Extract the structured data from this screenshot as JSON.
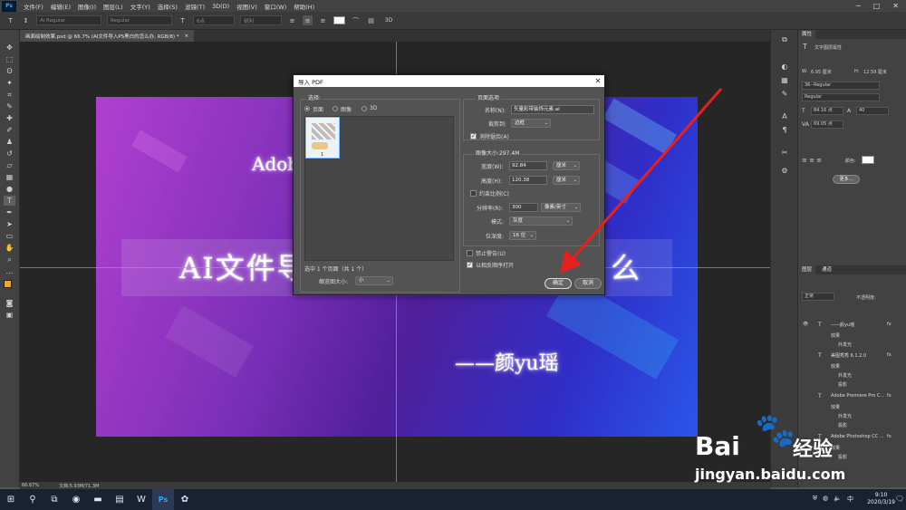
{
  "app": {
    "logo": "Ps",
    "menu": [
      "文件(F)",
      "编辑(E)",
      "图像(I)",
      "图层(L)",
      "文字(Y)",
      "选择(S)",
      "滤镜(T)",
      "3D(D)",
      "视图(V)",
      "窗口(W)",
      "帮助(H)"
    ],
    "window_controls": [
      "─",
      "□",
      "✕"
    ]
  },
  "options": {
    "font_family": "Ai Regular",
    "font_style": "Regular",
    "font_size": "6点",
    "aa": "锐利",
    "mode_3d": "3D"
  },
  "document_tab": {
    "title": "画面绘制效果.psd @ 66.7% (AI文件导入PS黑白的怎么办, RGB/8) *",
    "close": "×"
  },
  "artwork": {
    "line1": "Adob",
    "line2": "AI文件导",
    "line2_tail": "么",
    "author": "——颜yu瑶"
  },
  "dialog": {
    "title": "导入 PDF",
    "select_legend": "选择:",
    "radio_page": "页面",
    "radio_image": "图像",
    "radio_3d": "3D",
    "thumb_number": "1",
    "selected_info": "选中 1 个页面（共 1 个）",
    "thumb_size_label": "缩览图大小:",
    "thumb_size_value": "小",
    "page_options_legend": "页面选项",
    "name_label": "名称(N):",
    "name_value": "矢量彩带装饰元素.ai",
    "crop_label": "裁剪到:",
    "crop_value": "边框",
    "anti_alias_label": "消除锯齿(A)",
    "image_size_legend": "图像大小:297.4M",
    "width_label": "宽度(W):",
    "width_value": "92.84",
    "width_unit": "厘米",
    "height_label": "高度(H):",
    "height_value": "120.38",
    "height_unit": "厘米",
    "constrain_label": "约束比例(C)",
    "resolution_label": "分辨率(R):",
    "resolution_value": "300",
    "resolution_unit": "像素/英寸",
    "mode_label": "模式:",
    "mode_value": "灰度",
    "depth_label": "位深度:",
    "depth_value": "16 位",
    "suppress_label": "禁止警告(U)",
    "open_as_label": "以相反顺序打开",
    "ok": "确定",
    "cancel": "取消"
  },
  "properties_panel": {
    "tab": "属性",
    "subtitle": "文字图层属性",
    "w_label": "W:",
    "w_value": "6.95 厘米",
    "h_label": "H:",
    "h_value": "12.59 厘米",
    "x_label": "X:",
    "x_value": "",
    "y_label": "Y:",
    "y_value": "",
    "font": "36--Regular",
    "style": "Regular",
    "size": "84.16 点",
    "leading": "40",
    "tracking": "69.05 点",
    "color_label": "颜色:",
    "more": "更多..."
  },
  "layers_panel": {
    "tabs": [
      "图层",
      "通道"
    ],
    "kind": "正常",
    "opacity_label": "不透明度:",
    "rows": [
      {
        "name": "——颜yu瑶",
        "fx": "fx"
      },
      {
        "name": "效果",
        "fx": ""
      },
      {
        "name": "外发光",
        "fx": ""
      },
      {
        "name": "美图秀秀 6.1.2.0",
        "fx": "fx"
      },
      {
        "name": "效果",
        "fx": ""
      },
      {
        "name": "外发光",
        "fx": ""
      },
      {
        "name": "投影",
        "fx": ""
      },
      {
        "name": "Adobe Premiere Pro C...",
        "fx": "fx"
      },
      {
        "name": "效果",
        "fx": ""
      },
      {
        "name": "外发光",
        "fx": ""
      },
      {
        "name": "投影",
        "fx": ""
      },
      {
        "name": "Adobe Photoshop CC ...",
        "fx": "fx"
      },
      {
        "name": "效果",
        "fx": ""
      },
      {
        "name": "投影",
        "fx": ""
      }
    ]
  },
  "statusbar": {
    "zoom": "66.67%",
    "doc": "文档:5.93M/71.3M"
  },
  "taskbar": {
    "time": "9:10",
    "date": "2020/3/19",
    "ime": "中",
    "notifications": "🗨"
  },
  "watermark": {
    "brand": "Bai",
    "paw": "🐾",
    "suffix": "经验",
    "url": "jingyan.baidu.com"
  },
  "colors": {
    "accent_blue": "#31a8ff",
    "guide": "#00d9ff",
    "arrow": "#e8201c",
    "fg_swatch": "#f5a623"
  }
}
